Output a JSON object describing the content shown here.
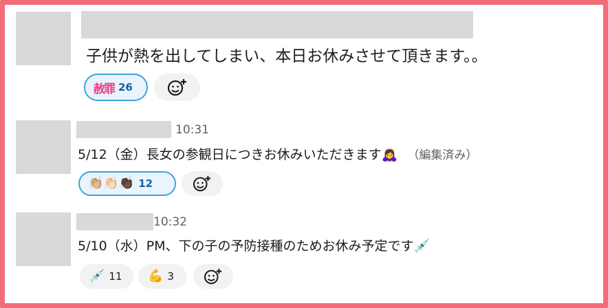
{
  "colors": {
    "border": "#f36b7a",
    "reaction_own_border": "#3fa2d8",
    "reaction_own_bg": "#eaf4fd"
  },
  "messages": [
    {
      "time": "",
      "text": "子供が熱を出してしまい、本日お休みさせて頂きます。。",
      "reactions": [
        {
          "emoji": "赦罪",
          "count": "26",
          "own": true
        }
      ]
    },
    {
      "time": "10:31",
      "text": "5/12（金）長女の参観日につきお休みいただきます🙇‍♀️",
      "edited": "（編集済み）",
      "reactions": [
        {
          "emoji": "👏🏼👏🏻👏🏿",
          "count": "12",
          "own": true
        }
      ]
    },
    {
      "time": "10:32",
      "text": "5/10（水）PM、下の子の予防接種のためお休み予定です💉",
      "reactions": [
        {
          "emoji": "💉",
          "count": "11",
          "own": false
        },
        {
          "emoji": "💪",
          "count": "3",
          "own": false
        }
      ]
    }
  ],
  "icons": {
    "add_reaction": "add-reaction-icon"
  }
}
